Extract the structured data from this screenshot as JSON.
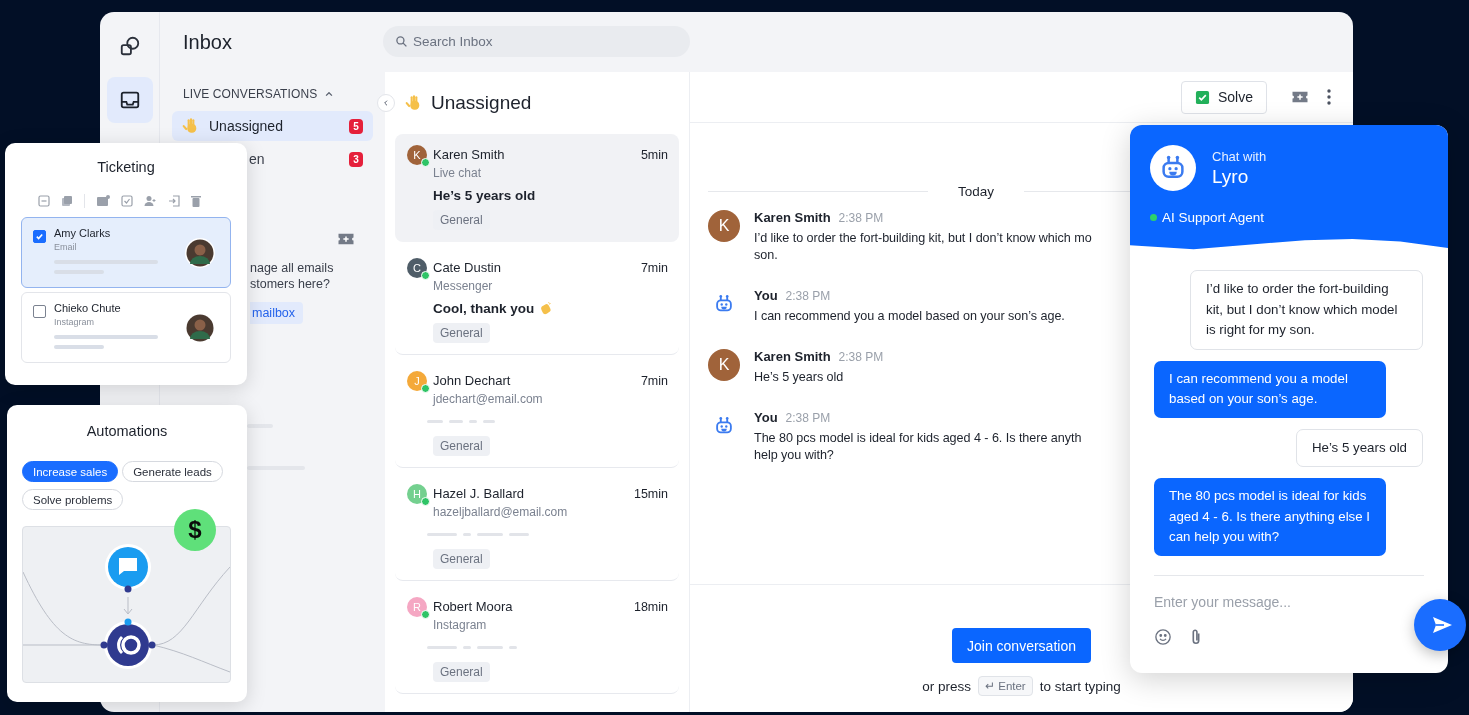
{
  "nav": {
    "title": "Inbox",
    "section": "LIVE CONVERSATIONS",
    "expanded": true,
    "items": [
      {
        "label": "Unassigned",
        "badge": "5",
        "selected": true
      },
      {
        "label": "en",
        "badge": "3",
        "selected": false
      }
    ],
    "promo": {
      "lines": [
        "nage all emails",
        "stomers here?"
      ],
      "button": "mailbox"
    }
  },
  "search": {
    "placeholder": "Search Inbox"
  },
  "conversations": {
    "title": "Unassigned",
    "items": [
      {
        "initial": "K",
        "color": "#a0633a",
        "name": "Karen Smith",
        "time": "5min",
        "channel": "Live chat",
        "preview": "He’s 5 years old",
        "reaction": false,
        "tag": "General",
        "online": true,
        "selected": true
      },
      {
        "initial": "C",
        "color": "#4f5d68",
        "name": "Cate Dustin",
        "time": "7min",
        "channel": "Messenger",
        "preview": "Cool, thank you",
        "reaction": true,
        "tag": "General",
        "online": true,
        "selected": false
      },
      {
        "initial": "J",
        "color": "#f4a93a",
        "name": "John Dechart",
        "time": "7min",
        "channel": "jdechart@email.com",
        "reaction": false,
        "tag": "General",
        "online": true,
        "selected": false
      },
      {
        "initial": "H",
        "color": "#74d08f",
        "name": "Hazel J. Ballard",
        "time": "15min",
        "channel": "hazeljballard@email.com",
        "reaction": false,
        "tag": "General",
        "online": true,
        "selected": false
      },
      {
        "initial": "R",
        "color": "#f5a7c3",
        "name": "Robert Moora",
        "time": "18min",
        "channel": "Instagram",
        "reaction": false,
        "tag": "General",
        "online": true,
        "selected": false
      }
    ]
  },
  "chat": {
    "solve": "Solve",
    "date": "Today",
    "messages": [
      {
        "kind": "customer",
        "initial": "K",
        "author": "Karen Smith",
        "time": "2:38 PM",
        "lines": [
          "I’d like to order the fort-building kit, but I don’t know which mo",
          "son."
        ]
      },
      {
        "kind": "bot",
        "author": "You",
        "time": "2:38 PM",
        "lines": [
          "I can recommend you a model based on your son’s age."
        ]
      },
      {
        "kind": "customer",
        "initial": "K",
        "author": "Karen Smith",
        "time": "2:38 PM",
        "lines": [
          "He’s 5 years old"
        ]
      },
      {
        "kind": "bot",
        "author": "You",
        "time": "2:38 PM",
        "lines": [
          "The 80 pcs model is ideal for kids aged 4 - 6. Is there anyth",
          "help you with?"
        ]
      }
    ],
    "join": "Join conversation",
    "hint": {
      "before": "or press",
      "key": "↵ Enter",
      "after": "to start typing"
    }
  },
  "lyro": {
    "subtitle": "Chat with",
    "name": "Lyro",
    "status": "AI Support Agent",
    "online": true,
    "messages": [
      {
        "kind": "user",
        "text": "I’d like to order the fort-building kit, but I don’t know which model is right for my son."
      },
      {
        "kind": "bot",
        "text": "I can recommend you a model based on your son’s age."
      },
      {
        "kind": "user",
        "text": "He’s 5 years old"
      },
      {
        "kind": "bot",
        "text": "The 80 pcs model is ideal for kids aged 4 - 6. Is there anything else I can help you with?"
      }
    ],
    "input": {
      "placeholder": "Enter your message..."
    }
  },
  "ticketing": {
    "title": "Ticketing",
    "tickets": [
      {
        "name": "Amy Clarks",
        "channel": "Email",
        "checked": true
      },
      {
        "name": "Chieko Chute",
        "channel": "Instagram",
        "checked": false
      }
    ]
  },
  "automations": {
    "title": "Automations",
    "chips": [
      {
        "label": "Increase sales",
        "selected": true
      },
      {
        "label": "Generate leads",
        "selected": false
      },
      {
        "label": "Solve problems",
        "selected": false
      }
    ],
    "badge": "$"
  }
}
